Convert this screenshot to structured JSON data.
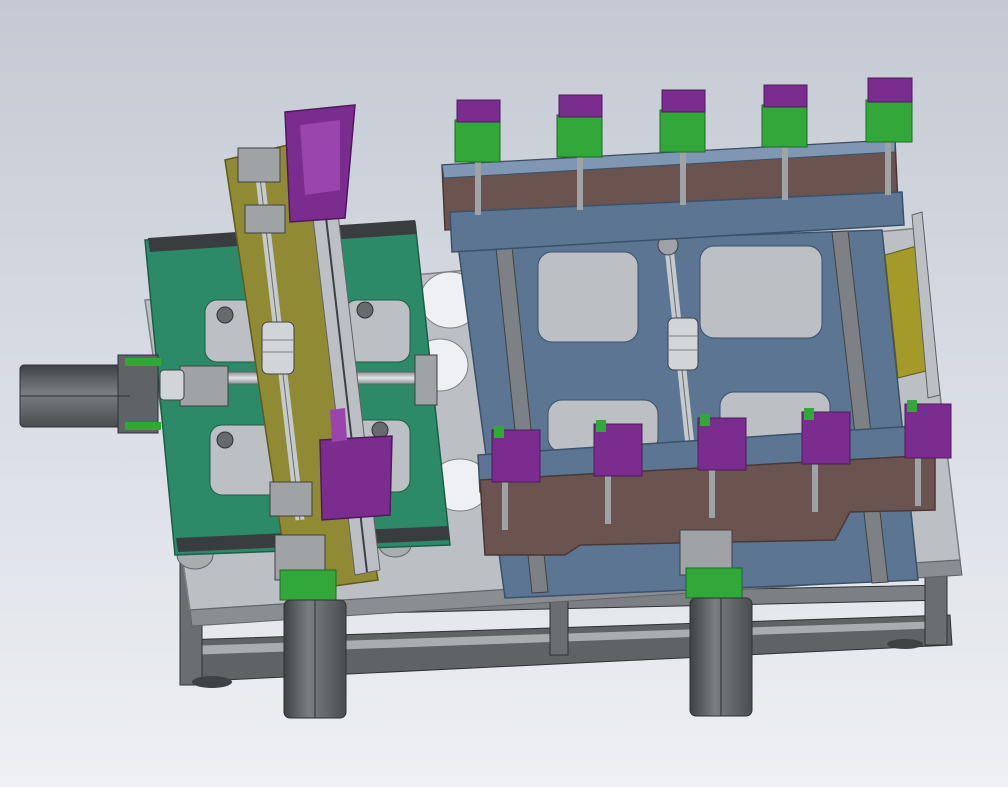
{
  "scene": {
    "background_top": "#c4c9d3",
    "background_bottom": "#eef0f4"
  },
  "colors": {
    "frame_dark": "#5f6366",
    "frame_light": "#a9adb0",
    "frame_rail": "#c9cccf",
    "base_plate": "#bcbfc3",
    "base_plate_edge": "#7c8084",
    "green_plate": "#2c8a69",
    "green_plate_edge": "#1d5e46",
    "olive_arm": "#908a34",
    "olive_arm_dark": "#5e5a20",
    "blue_plate": "#5b7593",
    "blue_plate_edge": "#3b516b",
    "brown_plate": "#6b5350",
    "brown_plate_edge": "#4a3836",
    "purple_block": "#7a2d8f",
    "purple_dark": "#4e1a5d",
    "green_block": "#33a83a",
    "green_block_dark": "#1f6a24",
    "motor_body": "#676b6e",
    "motor_dark": "#3f4244",
    "shaft": "#b4b8bb",
    "coupling": "#d2d5d8",
    "linear_rail": "#7d8185",
    "yellow_bracket": "#a49a2a"
  },
  "icons": {
    "main_motor": "servo-motor-icon",
    "shaft_coupling": "coupling-icon"
  }
}
